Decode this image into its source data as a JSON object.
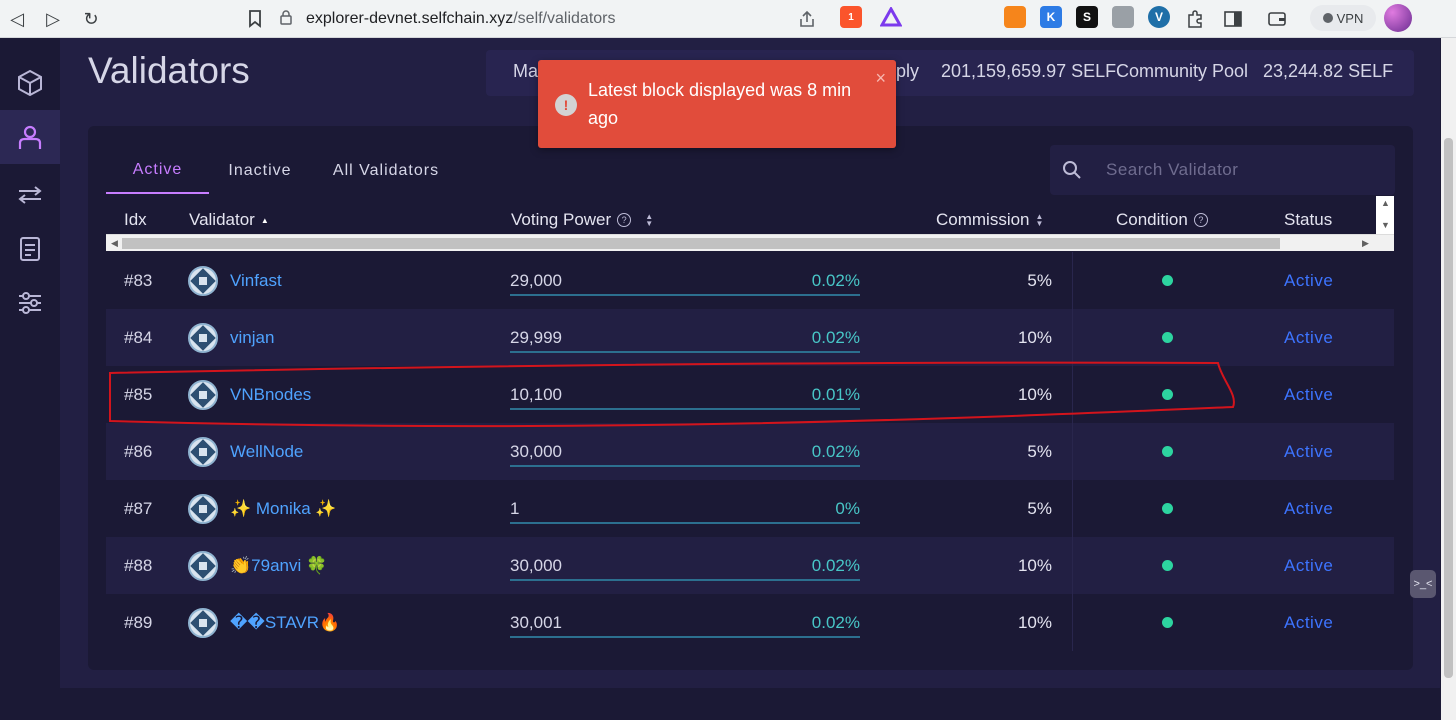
{
  "browser": {
    "url_host": "explorer-devnet.selfchain.xyz",
    "url_path": "/self/validators",
    "brave_badge": "1",
    "vpn_label": "VPN"
  },
  "page": {
    "title": "Validators"
  },
  "stats": {
    "first_label": "Ma",
    "supply_label": "pply",
    "supply_value": "201,159,659.97 SELF",
    "pool_label": "Community Pool",
    "pool_value": "23,244.82 SELF"
  },
  "toast": {
    "message": "Latest block displayed was 8 min ago",
    "close": "×",
    "icon": "!"
  },
  "tabs": [
    {
      "label": "Active",
      "active": true
    },
    {
      "label": "Inactive",
      "active": false
    },
    {
      "label": "All Validators",
      "active": false
    }
  ],
  "search": {
    "placeholder": "Search Validator",
    "value": ""
  },
  "columns": {
    "idx": "Idx",
    "validator": "Validator",
    "voting_power": "Voting Power",
    "commission": "Commission",
    "condition": "Condition",
    "status": "Status"
  },
  "rows": [
    {
      "idx": "#83",
      "name": "Vinfast",
      "power": "29,000",
      "pct": "0.02%",
      "commission": "5%",
      "status": "Active"
    },
    {
      "idx": "#84",
      "name": "vinjan",
      "power": "29,999",
      "pct": "0.02%",
      "commission": "10%",
      "status": "Active"
    },
    {
      "idx": "#85",
      "name": "VNBnodes",
      "power": "10,100",
      "pct": "0.01%",
      "commission": "10%",
      "status": "Active"
    },
    {
      "idx": "#86",
      "name": "WellNode",
      "power": "30,000",
      "pct": "0.02%",
      "commission": "5%",
      "status": "Active"
    },
    {
      "idx": "#87",
      "name": "✨ Monika ✨",
      "power": "1",
      "pct": "0%",
      "commission": "5%",
      "status": "Active"
    },
    {
      "idx": "#88",
      "name": "👏79anvi 🍀",
      "power": "30,000",
      "pct": "0.02%",
      "commission": "10%",
      "status": "Active"
    },
    {
      "idx": "#89",
      "name": "��STAVR🔥",
      "power": "30,001",
      "pct": "0.02%",
      "commission": "10%",
      "status": "Active"
    }
  ],
  "colors": {
    "accent": "#c77dff",
    "link": "#4fa3ff",
    "status_active": "#3d74ff",
    "condition_ok": "#2dd4a0",
    "toast_bg": "#e14c3b",
    "highlight": "#d3141c"
  }
}
